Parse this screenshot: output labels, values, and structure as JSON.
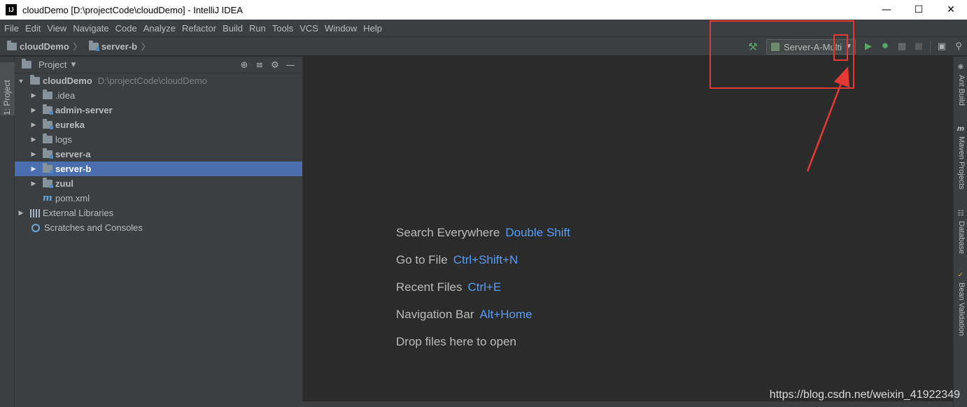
{
  "window": {
    "app_icon": "IJ",
    "title": "cloudDemo [D:\\projectCode\\cloudDemo] - IntelliJ IDEA",
    "controls": [
      "minimize-icon",
      "maximize-icon",
      "close-icon"
    ]
  },
  "menu": [
    "File",
    "Edit",
    "View",
    "Navigate",
    "Code",
    "Analyze",
    "Refactor",
    "Build",
    "Run",
    "Tools",
    "VCS",
    "Window",
    "Help"
  ],
  "breadcrumb": [
    "cloudDemo",
    "server-b"
  ],
  "toolbar": {
    "run_config": "Server-A-Multi",
    "icons": [
      "build-hammer-icon",
      "run-config-dropdown-icon",
      "run-icon",
      "debug-icon",
      "coverage-icon",
      "stop-icon",
      "project-structure-icon",
      "search-icon"
    ]
  },
  "left_stripe": {
    "tab_label": "1: Project"
  },
  "project_panel": {
    "title": "Project",
    "tree": [
      {
        "label": "cloudDemo",
        "path": "D:\\projectCode\\cloudDemo",
        "expanded": true,
        "bold": true,
        "level": 0
      },
      {
        "label": ".idea",
        "level": 1,
        "bold": false
      },
      {
        "label": "admin-server",
        "level": 1,
        "bold": true
      },
      {
        "label": "eureka",
        "level": 1,
        "bold": true
      },
      {
        "label": "logs",
        "level": 1,
        "bold": false
      },
      {
        "label": "server-a",
        "level": 1,
        "bold": true
      },
      {
        "label": "server-b",
        "level": 1,
        "bold": true,
        "selected": true
      },
      {
        "label": "zuul",
        "level": 1,
        "bold": true
      },
      {
        "label": "pom.xml",
        "level": 1,
        "bold": false
      },
      {
        "label": "External Libraries",
        "level": 0
      },
      {
        "label": "Scratches and Consoles",
        "level": 0
      }
    ]
  },
  "editor_hints": [
    {
      "text": "Search Everywhere",
      "key": "Double Shift"
    },
    {
      "text": "Go to File",
      "key": "Ctrl+Shift+N"
    },
    {
      "text": "Recent Files",
      "key": "Ctrl+E"
    },
    {
      "text": "Navigation Bar",
      "key": "Alt+Home"
    },
    {
      "text": "Drop files here to open",
      "key": ""
    }
  ],
  "right_stripe": [
    "Ant Build",
    "Maven Projects",
    "Database",
    "Bean Validation"
  ],
  "watermark": "https://blog.csdn.net/weixin_41922349",
  "colors": {
    "accent": "#4b6eaf",
    "shortcut": "#589df6",
    "annotation": "#e53935"
  }
}
